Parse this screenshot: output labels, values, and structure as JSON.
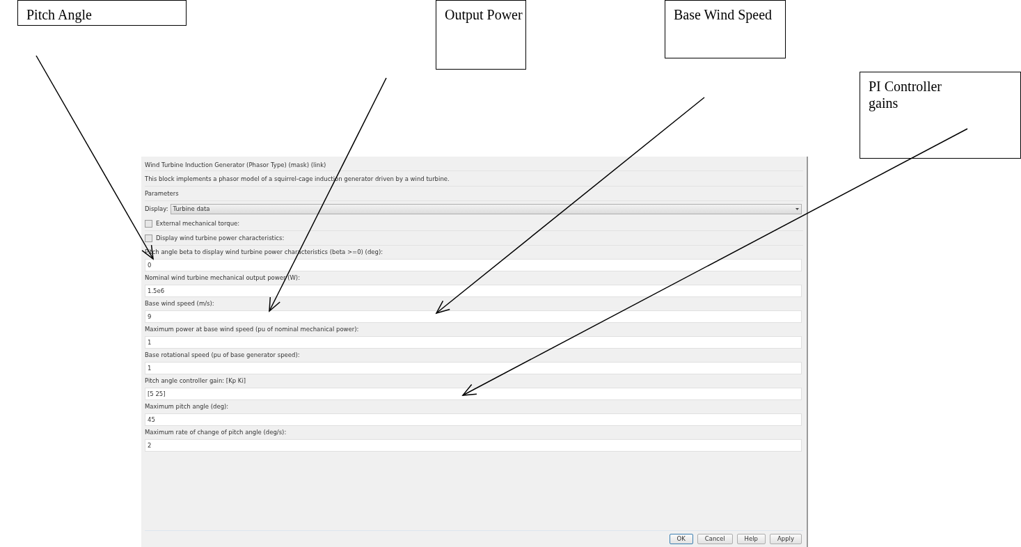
{
  "callouts": [
    {
      "text": "Pitch Angle"
    },
    {
      "text": "Output Power"
    },
    {
      "text": "Base Wind Speed"
    },
    {
      "text": "PI Controller gains"
    }
  ],
  "dialog": {
    "title": "Wind Turbine Induction Generator (Phasor Type) (mask) (link)",
    "description": "This block implements a phasor model of a squirrel-cage induction generator driven by a wind turbine.",
    "section": "Parameters",
    "display": {
      "label": "Display:",
      "value": "Turbine data"
    },
    "checkboxes": [
      {
        "label": "External mechanical torque:",
        "checked": false
      },
      {
        "label": "Display wind turbine power characteristics:",
        "checked": false
      }
    ],
    "fields": [
      {
        "label": "Pitch angle beta to display wind turbine power characteristics (beta >=0)  (deg):",
        "value": "0"
      },
      {
        "label": "Nominal wind turbine mechanical output power (W):",
        "value": "1.5e6"
      },
      {
        "label": "Base wind speed (m/s):",
        "value": "9"
      },
      {
        "label": "Maximum power at base wind speed (pu of nominal mechanical power):",
        "value": "1"
      },
      {
        "label": "Base rotational speed (pu of base generator speed):",
        "value": "1"
      },
      {
        "label": "Pitch angle controller gain: [Kp Ki]",
        "value": "[5 25]"
      },
      {
        "label": "Maximum pitch angle (deg):",
        "value": "45"
      },
      {
        "label": "Maximum rate of change of pitch angle (deg/s):",
        "value": "2"
      }
    ],
    "buttons": [
      {
        "label": "OK",
        "selected": true
      },
      {
        "label": "Cancel",
        "selected": false
      },
      {
        "label": "Help",
        "selected": false
      },
      {
        "label": "Apply",
        "selected": false
      }
    ]
  }
}
